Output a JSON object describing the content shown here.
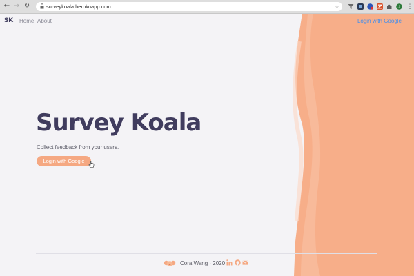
{
  "browser": {
    "url": "surveykoala.herokuapp.com",
    "icons": [
      "back-icon",
      "forward-icon",
      "reload-icon",
      "lock-icon",
      "star-icon"
    ]
  },
  "nav": {
    "brand": "SK",
    "home": "Home",
    "about": "About",
    "login": "Login with Google"
  },
  "hero": {
    "title": "Survey Koala",
    "subtitle": "Collect feedback from your users.",
    "button": "Login with Google"
  },
  "footer": {
    "text": "Cora Wang · 2020",
    "icons": [
      "linkedin-icon",
      "github-icon",
      "mail-icon"
    ]
  },
  "colors": {
    "accent": "#f5a882",
    "title": "#403c5e",
    "link": "#3d8ef0",
    "background": "#f4f3f6"
  }
}
